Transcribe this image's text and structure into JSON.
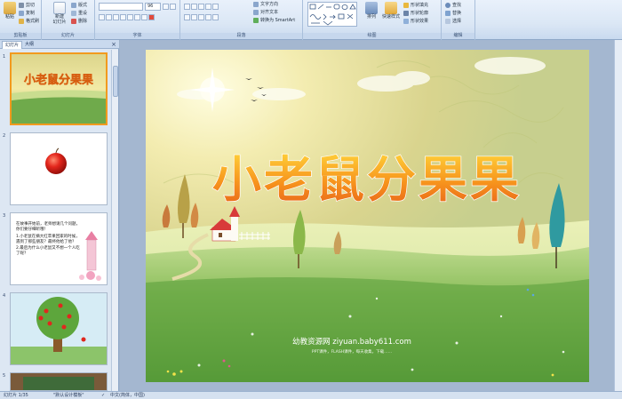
{
  "ribbon": {
    "clipboard": {
      "paste": "粘贴",
      "cut": "剪切",
      "copy": "复制",
      "format_painter": "格式刷",
      "label": "剪贴板"
    },
    "slides": {
      "new_slide": "新建\n幻灯片",
      "layout": "版式",
      "reset": "重设",
      "delete": "删除",
      "label": "幻灯片"
    },
    "font": {
      "font_name": "",
      "font_size": "96",
      "label": "字体"
    },
    "paragraph": {
      "text_direction": "文字方向",
      "align_text": "对齐文本",
      "smartart": "转换为 SmartArt",
      "label": "段落"
    },
    "drawing": {
      "arrange": "排列",
      "quick_styles": "快速样式",
      "shape_fill": "形状填充",
      "shape_outline": "形状轮廓",
      "shape_effects": "形状效果",
      "label": "绘图"
    },
    "editing": {
      "find": "查找",
      "replace": "替换",
      "select": "选择",
      "label": "编辑"
    }
  },
  "left_panel": {
    "tab_slides": "幻灯片",
    "tab_outline": "大纲",
    "close": "×",
    "slide_numbers": [
      "1",
      "2",
      "3",
      "4",
      "5"
    ],
    "thumb1_title": "小老鼠分果果",
    "thumb3_text": {
      "intro": "在故事开始前，老师想请几个问题，你们要仔细听哦！",
      "q1": "1.小老鼠在摘大红苹果回家的时候，遇到了那些朋友？最终他给了他？",
      "q2": "2.最后为什么小老鼠又不想一个人吃了呢？"
    }
  },
  "slide": {
    "title": "小老鼠分果果",
    "watermark_main": "幼教资源网 ziyuan.baby611.com",
    "watermark_sub": "PPT课件，FLASH课件，每天收集，下载……"
  },
  "status": {
    "slide_info": "幻灯片 1/35",
    "theme": "\"默认设计模板\"",
    "language": "中文(简体，中国)"
  },
  "colors": {
    "accent_orange": "#f29a1e",
    "ribbon_blue": "#dbe7f5",
    "title_orange": "#f7941d"
  }
}
